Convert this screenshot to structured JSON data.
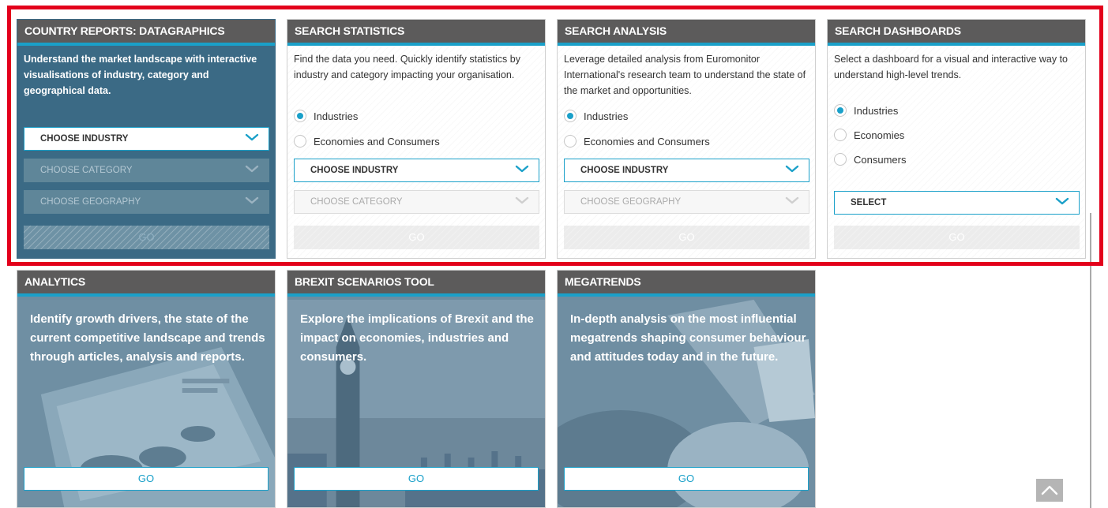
{
  "top_cards": [
    {
      "title": "COUNTRY REPORTS: DATAGRAPHICS",
      "description": "Understand the market landscape with interactive visualisations of industry, category and geographical data.",
      "selects": [
        "CHOOSE INDUSTRY",
        "CHOOSE CATEGORY",
        "CHOOSE GEOGRAPHY"
      ],
      "go_label": "GO"
    },
    {
      "title": "SEARCH STATISTICS",
      "description": "Find the data you need. Quickly identify statistics by industry and category impacting your organisation.",
      "radios": [
        "Industries",
        "Economies and Consumers"
      ],
      "selects": [
        "CHOOSE INDUSTRY",
        "CHOOSE CATEGORY"
      ],
      "go_label": "GO"
    },
    {
      "title": "SEARCH ANALYSIS",
      "description": "Leverage detailed analysis from Euromonitor International's research team to understand the state of the market and opportunities.",
      "radios": [
        "Industries",
        "Economies and Consumers"
      ],
      "selects": [
        "CHOOSE INDUSTRY",
        "CHOOSE GEOGRAPHY"
      ],
      "go_label": "GO"
    },
    {
      "title": "SEARCH DASHBOARDS",
      "description": "Select a dashboard for a visual and interactive way to understand high-level trends.",
      "radios": [
        "Industries",
        "Economies",
        "Consumers"
      ],
      "selects": [
        "SELECT"
      ],
      "go_label": "GO"
    }
  ],
  "bottom_cards": [
    {
      "title": "ANALYTICS",
      "description": "Identify growth drivers, the state of the current competitive landscape and trends through articles, analysis and reports.",
      "go_label": "GO"
    },
    {
      "title": "BREXIT SCENARIOS TOOL",
      "description": "Explore the implications of Brexit and the impact on economies, industries and consumers.",
      "go_label": "GO"
    },
    {
      "title": "MEGATRENDS",
      "description": "In-depth analysis on the most influential megatrends shaping consumer behaviour and attitudes today and in the future.",
      "go_label": "GO"
    }
  ],
  "colors": {
    "accent": "#1aa0c9",
    "header": "#5c5b5b",
    "dark_card": "#3b6a85",
    "highlight": "#e3001b"
  },
  "icons": {
    "select_arrow": "chevron-down-icon",
    "back_to_top": "chevron-up-icon"
  }
}
